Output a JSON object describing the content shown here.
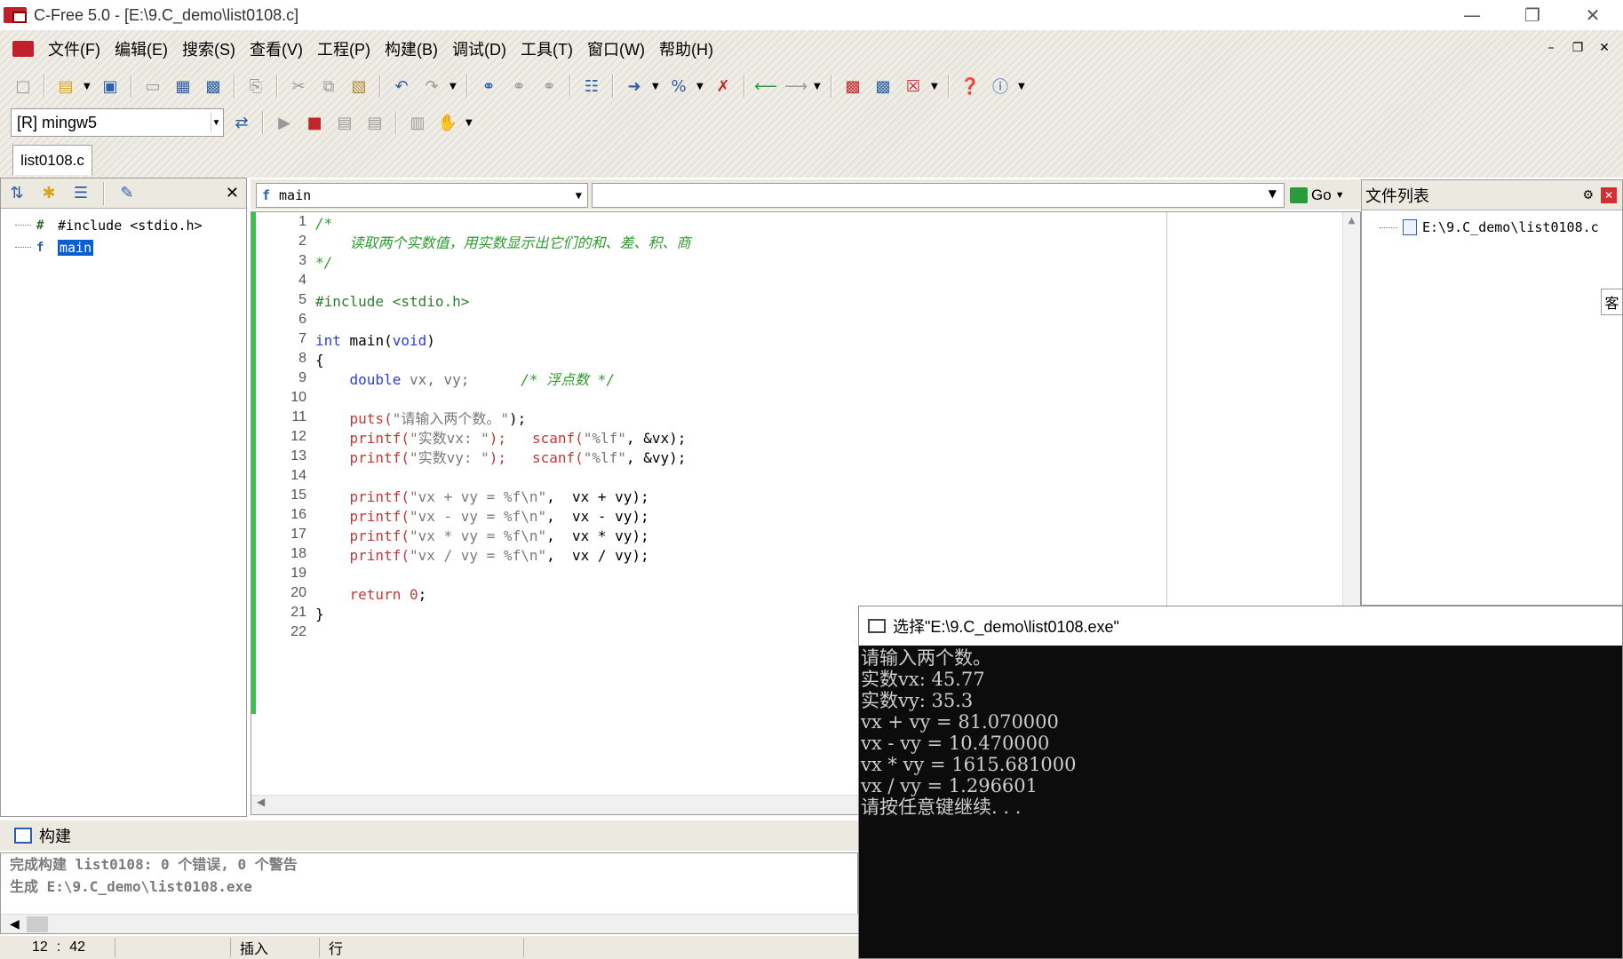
{
  "window": {
    "title": "C-Free 5.0 - [E:\\9.C_demo\\list0108.c]"
  },
  "menu": [
    "文件(F)",
    "编辑(E)",
    "搜索(S)",
    "查看(V)",
    "工程(P)",
    "构建(B)",
    "调试(D)",
    "工具(T)",
    "窗口(W)",
    "帮助(H)"
  ],
  "toolbar": {
    "compiler": "[R] mingw5"
  },
  "file_tab": "list0108.c",
  "class_tree": {
    "items": [
      {
        "icon": "#",
        "label": "#include <stdio.h>"
      },
      {
        "icon": "f",
        "label": "main"
      }
    ]
  },
  "function_bar": {
    "current": "main",
    "go_label": "Go"
  },
  "editor": {
    "line_numbers": [
      "1",
      "2",
      "3",
      "4",
      "5",
      "6",
      "7",
      "8",
      "9",
      "10",
      "11",
      "12",
      "13",
      "14",
      "15",
      "16",
      "17",
      "18",
      "19",
      "20",
      "21",
      "22"
    ],
    "code": {
      "l1": "/*",
      "l2": "    读取两个实数值，用实数显示出它们的和、差、积、商",
      "l3": "*/",
      "l5_pp": "#include <stdio.h>",
      "l7_kw1": "int",
      "l7_fn": " main(",
      "l7_kw2": "void",
      "l7_end": ")",
      "l8": "{",
      "l9_kw": "    double",
      "l9_vars": " vx, vy;",
      "l9_cmt": "      /* 浮点数 */",
      "l11_fn": "    puts(",
      "l11_str": "\"请输入两个数。\"",
      "l11_end": ");",
      "l12_fn": "    printf(",
      "l12_str": "\"实数vx: \"",
      "l12_mid": ");   scanf(",
      "l12_str2": "\"%lf\"",
      "l12_end": ", &vx);",
      "l13_fn": "    printf(",
      "l13_str": "\"实数vy: \"",
      "l13_mid": ");   scanf(",
      "l13_str2": "\"%lf\"",
      "l13_end": ", &vy);",
      "l15_fn": "    printf(",
      "l15_str": "\"vx + vy = %f\\n\"",
      "l15_end": ",  vx + vy);",
      "l16_fn": "    printf(",
      "l16_str": "\"vx - vy = %f\\n\"",
      "l16_end": ",  vx - vy);",
      "l17_fn": "    printf(",
      "l17_str": "\"vx * vy = %f\\n\"",
      "l17_end": ",  vx * vy);",
      "l18_fn": "    printf(",
      "l18_str": "\"vx / vy = %f\\n\"",
      "l18_end": ",  vx / vy);",
      "l20_kw": "    return",
      "l20_num": " 0",
      "l20_end": ";",
      "l21": "}"
    }
  },
  "file_list": {
    "title": "文件列表",
    "entry": "E:\\9.C_demo\\list0108.c",
    "side_tab": "客"
  },
  "build": {
    "title": "构建",
    "lines": [
      "完成构建 list0108: 0 个错误, 0 个警告",
      "生成 E:\\9.C_demo\\list0108.exe"
    ]
  },
  "status": {
    "row": "12",
    "sep": ":",
    "col": "42",
    "mode": "插入",
    "label": "行"
  },
  "console": {
    "title": "选择\"E:\\9.C_demo\\list0108.exe\"",
    "lines": [
      "请输入两个数。",
      "实数vx: 45.77",
      "实数vy: 35.3",
      "vx + vy = 81.070000",
      "vx - vy = 10.470000",
      "vx * vy = 1615.681000",
      "vx / vy = 1.296601",
      "请按任意键继续. . ."
    ]
  },
  "colors": {
    "comment": "#2e9a2e",
    "keyword": "#2b3fcf",
    "selection": "#0a5fd0",
    "gutter_mark": "#35c44a"
  }
}
